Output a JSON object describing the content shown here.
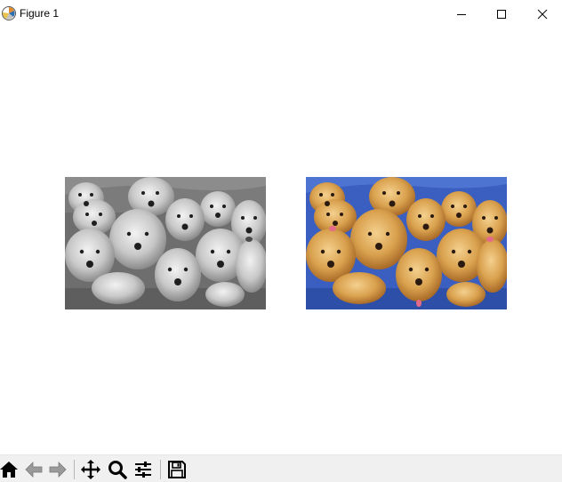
{
  "window": {
    "title": "Figure 1",
    "icon": "matplotlib-icon",
    "controls": [
      "minimize-icon",
      "maximize-icon",
      "close-icon"
    ]
  },
  "figure": {
    "subplots": [
      {
        "image": "golden-retriever-puppies-grayscale",
        "colormap": "gray"
      },
      {
        "image": "golden-retriever-puppies-color",
        "background_color": "#3a5fc0",
        "fur_color": "#d9a14e"
      }
    ]
  },
  "toolbar": {
    "buttons": [
      "home-icon",
      "back-icon",
      "forward-icon",
      "pan-icon",
      "zoom-icon",
      "configure-subplots-icon",
      "save-icon"
    ]
  }
}
